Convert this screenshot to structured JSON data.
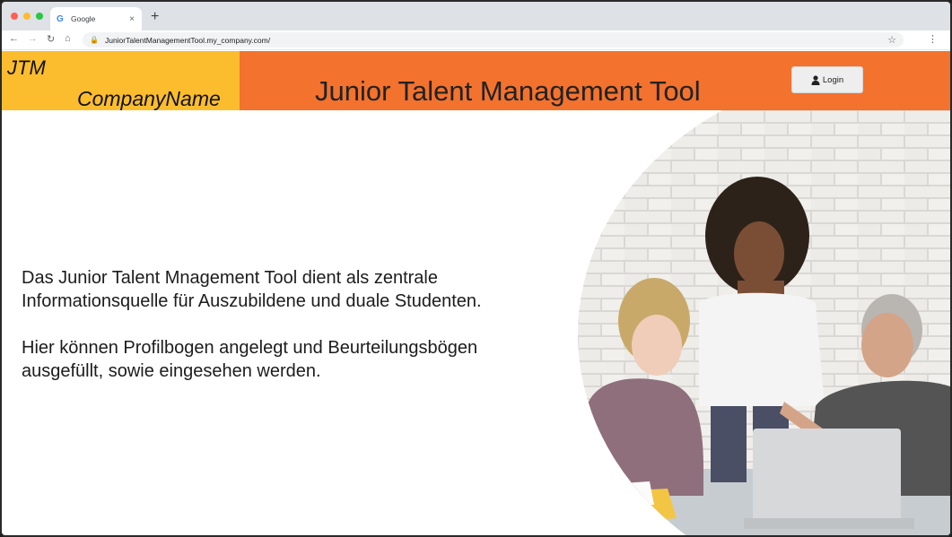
{
  "browser": {
    "tab_title": "Google",
    "tab_favicon": "G",
    "tab_close": "×",
    "new_tab": "+",
    "url": "JuniorTalentManagementTool.my_company.com/",
    "icons": [
      "back-arrow-icon",
      "forward-arrow-icon",
      "reload-icon",
      "home-icon",
      "lock-icon",
      "bookmark-star-icon",
      "more-menu-icon"
    ]
  },
  "header": {
    "brand_short": "JTM",
    "brand_name": "CompanyName",
    "title": "Junior Talent Management Tool",
    "login_label": "Login",
    "brand_color": "#fbbd2e",
    "banner_color": "#f2722e"
  },
  "main": {
    "paragraph_1": [
      "Das Junior Talent Mnagement Tool dient  als zentrale",
      "Informationsquelle für Auszubildene und duale Studenten."
    ],
    "paragraph_2": [
      "Hier können Profilbogen angelegt und Beurteilungsbögen",
      "ausgefüllt, sowie eingesehen werden."
    ],
    "photo": "team-at-laptop-photo"
  }
}
